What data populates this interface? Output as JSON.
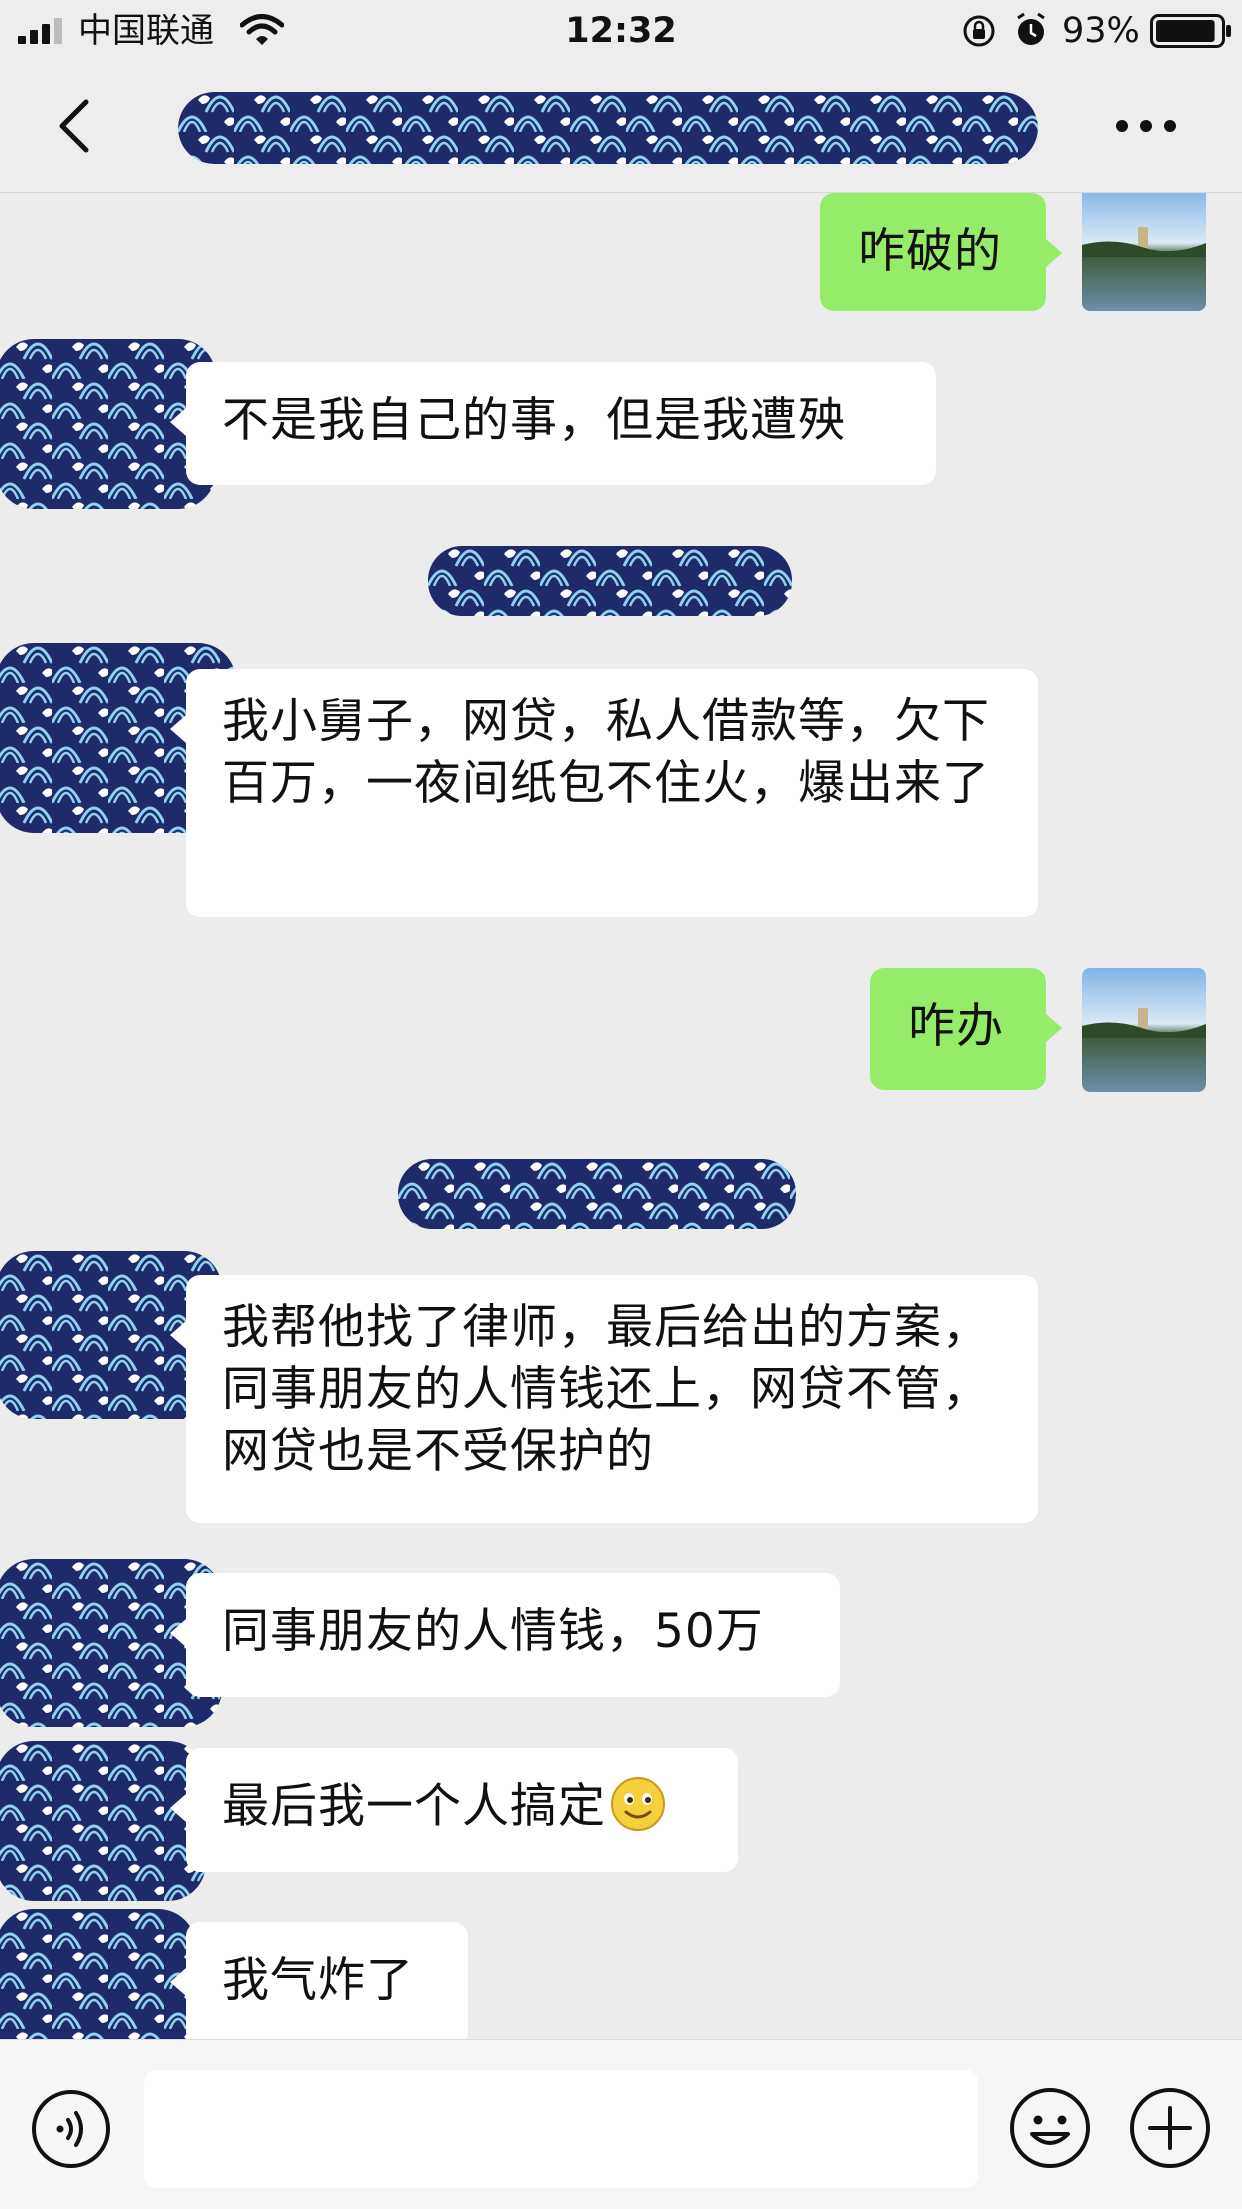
{
  "status_bar": {
    "carrier": "中国联通",
    "time": "12:32",
    "battery_percent": "93%",
    "battery_level": 0.93
  },
  "nav": {
    "back_icon": "chevron-left-icon",
    "more_icon": "ellipsis-icon"
  },
  "messages": [
    {
      "sender": "self",
      "text": "咋破的"
    },
    {
      "sender": "other",
      "text": "不是我自己的事，但是我遭殃"
    },
    {
      "sender": "other",
      "text": "我小舅子，网贷，私人借款等，欠下百万，一夜间纸包不住火，爆出来了"
    },
    {
      "sender": "self",
      "text": "咋办"
    },
    {
      "sender": "other",
      "text": "我帮他找了律师，最后给出的方案，同事朋友的人情钱还上，网贷不管，网贷也是不受保护的"
    },
    {
      "sender": "other",
      "text": "同事朋友的人情钱，50万"
    },
    {
      "sender": "other",
      "text": "最后我一个人搞定"
    },
    {
      "sender": "other",
      "text": "我气炸了"
    }
  ],
  "input_bar": {
    "placeholder": "",
    "voice_icon": "voice-icon",
    "emoji_icon": "emoji-icon",
    "plus_icon": "plus-icon"
  },
  "colors": {
    "background": "#ececec",
    "self_bubble": "#95ec69",
    "other_bubble": "#ffffff",
    "redaction_navy": "#1f2a6b",
    "redaction_light": "#8fd3f0"
  }
}
